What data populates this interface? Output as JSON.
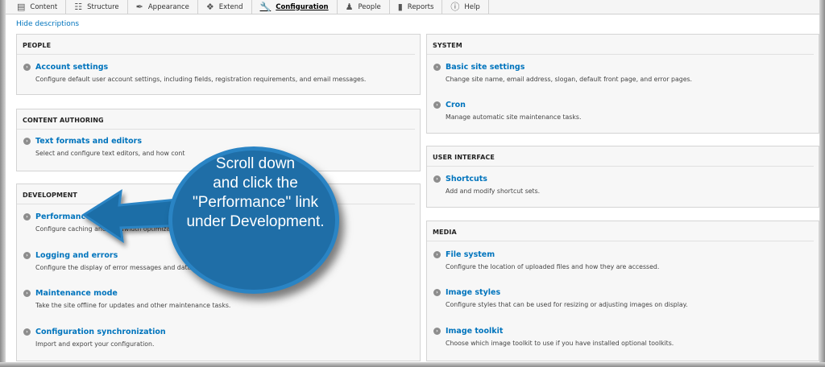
{
  "toolbar": {
    "items": [
      {
        "label": "Content",
        "icon": "content-icon"
      },
      {
        "label": "Structure",
        "icon": "structure-icon"
      },
      {
        "label": "Appearance",
        "icon": "appearance-icon"
      },
      {
        "label": "Extend",
        "icon": "extend-icon"
      },
      {
        "label": "Configuration",
        "icon": "configuration-icon",
        "active": true
      },
      {
        "label": "People",
        "icon": "people-icon"
      },
      {
        "label": "Reports",
        "icon": "reports-icon"
      },
      {
        "label": "Help",
        "icon": "help-icon"
      }
    ]
  },
  "hide_descriptions": "Hide descriptions",
  "panels": {
    "people": {
      "title": "PEOPLE",
      "items": [
        {
          "link": "Account settings",
          "desc": "Configure default user account settings, including fields, registration requirements, and email messages."
        }
      ]
    },
    "content_authoring": {
      "title": "CONTENT AUTHORING",
      "items": [
        {
          "link": "Text formats and editors",
          "desc": "Select and configure text editors, and how cont"
        }
      ]
    },
    "development": {
      "title": "DEVELOPMENT",
      "items": [
        {
          "link": "Performance",
          "desc": "Configure caching and bandwidth optimiza"
        },
        {
          "link": "Logging and errors",
          "desc": "Configure the display of error messages and datab"
        },
        {
          "link": "Maintenance mode",
          "desc": "Take the site offline for updates and other maintenance tasks."
        },
        {
          "link": "Configuration synchronization",
          "desc": "Import and export your configuration."
        }
      ]
    },
    "system": {
      "title": "SYSTEM",
      "items": [
        {
          "link": "Basic site settings",
          "desc": "Change site name, email address, slogan, default front page, and error pages."
        },
        {
          "link": "Cron",
          "desc": "Manage automatic site maintenance tasks."
        }
      ]
    },
    "user_interface": {
      "title": "USER INTERFACE",
      "items": [
        {
          "link": "Shortcuts",
          "desc": "Add and modify shortcut sets."
        }
      ]
    },
    "media": {
      "title": "MEDIA",
      "items": [
        {
          "link": "File system",
          "desc": "Configure the location of uploaded files and how they are accessed."
        },
        {
          "link": "Image styles",
          "desc": "Configure styles that can be used for resizing or adjusting images on display."
        },
        {
          "link": "Image toolkit",
          "desc": "Choose which image toolkit to use if you have installed optional toolkits."
        }
      ]
    }
  },
  "callout": {
    "line1": "Scroll down",
    "line2": "and click the",
    "line3": "\"Performance\" link",
    "line4": "under Development."
  },
  "colors": {
    "link": "#0074bd",
    "callout_fill": "#1f6ea7",
    "callout_border": "#2a84c4"
  }
}
